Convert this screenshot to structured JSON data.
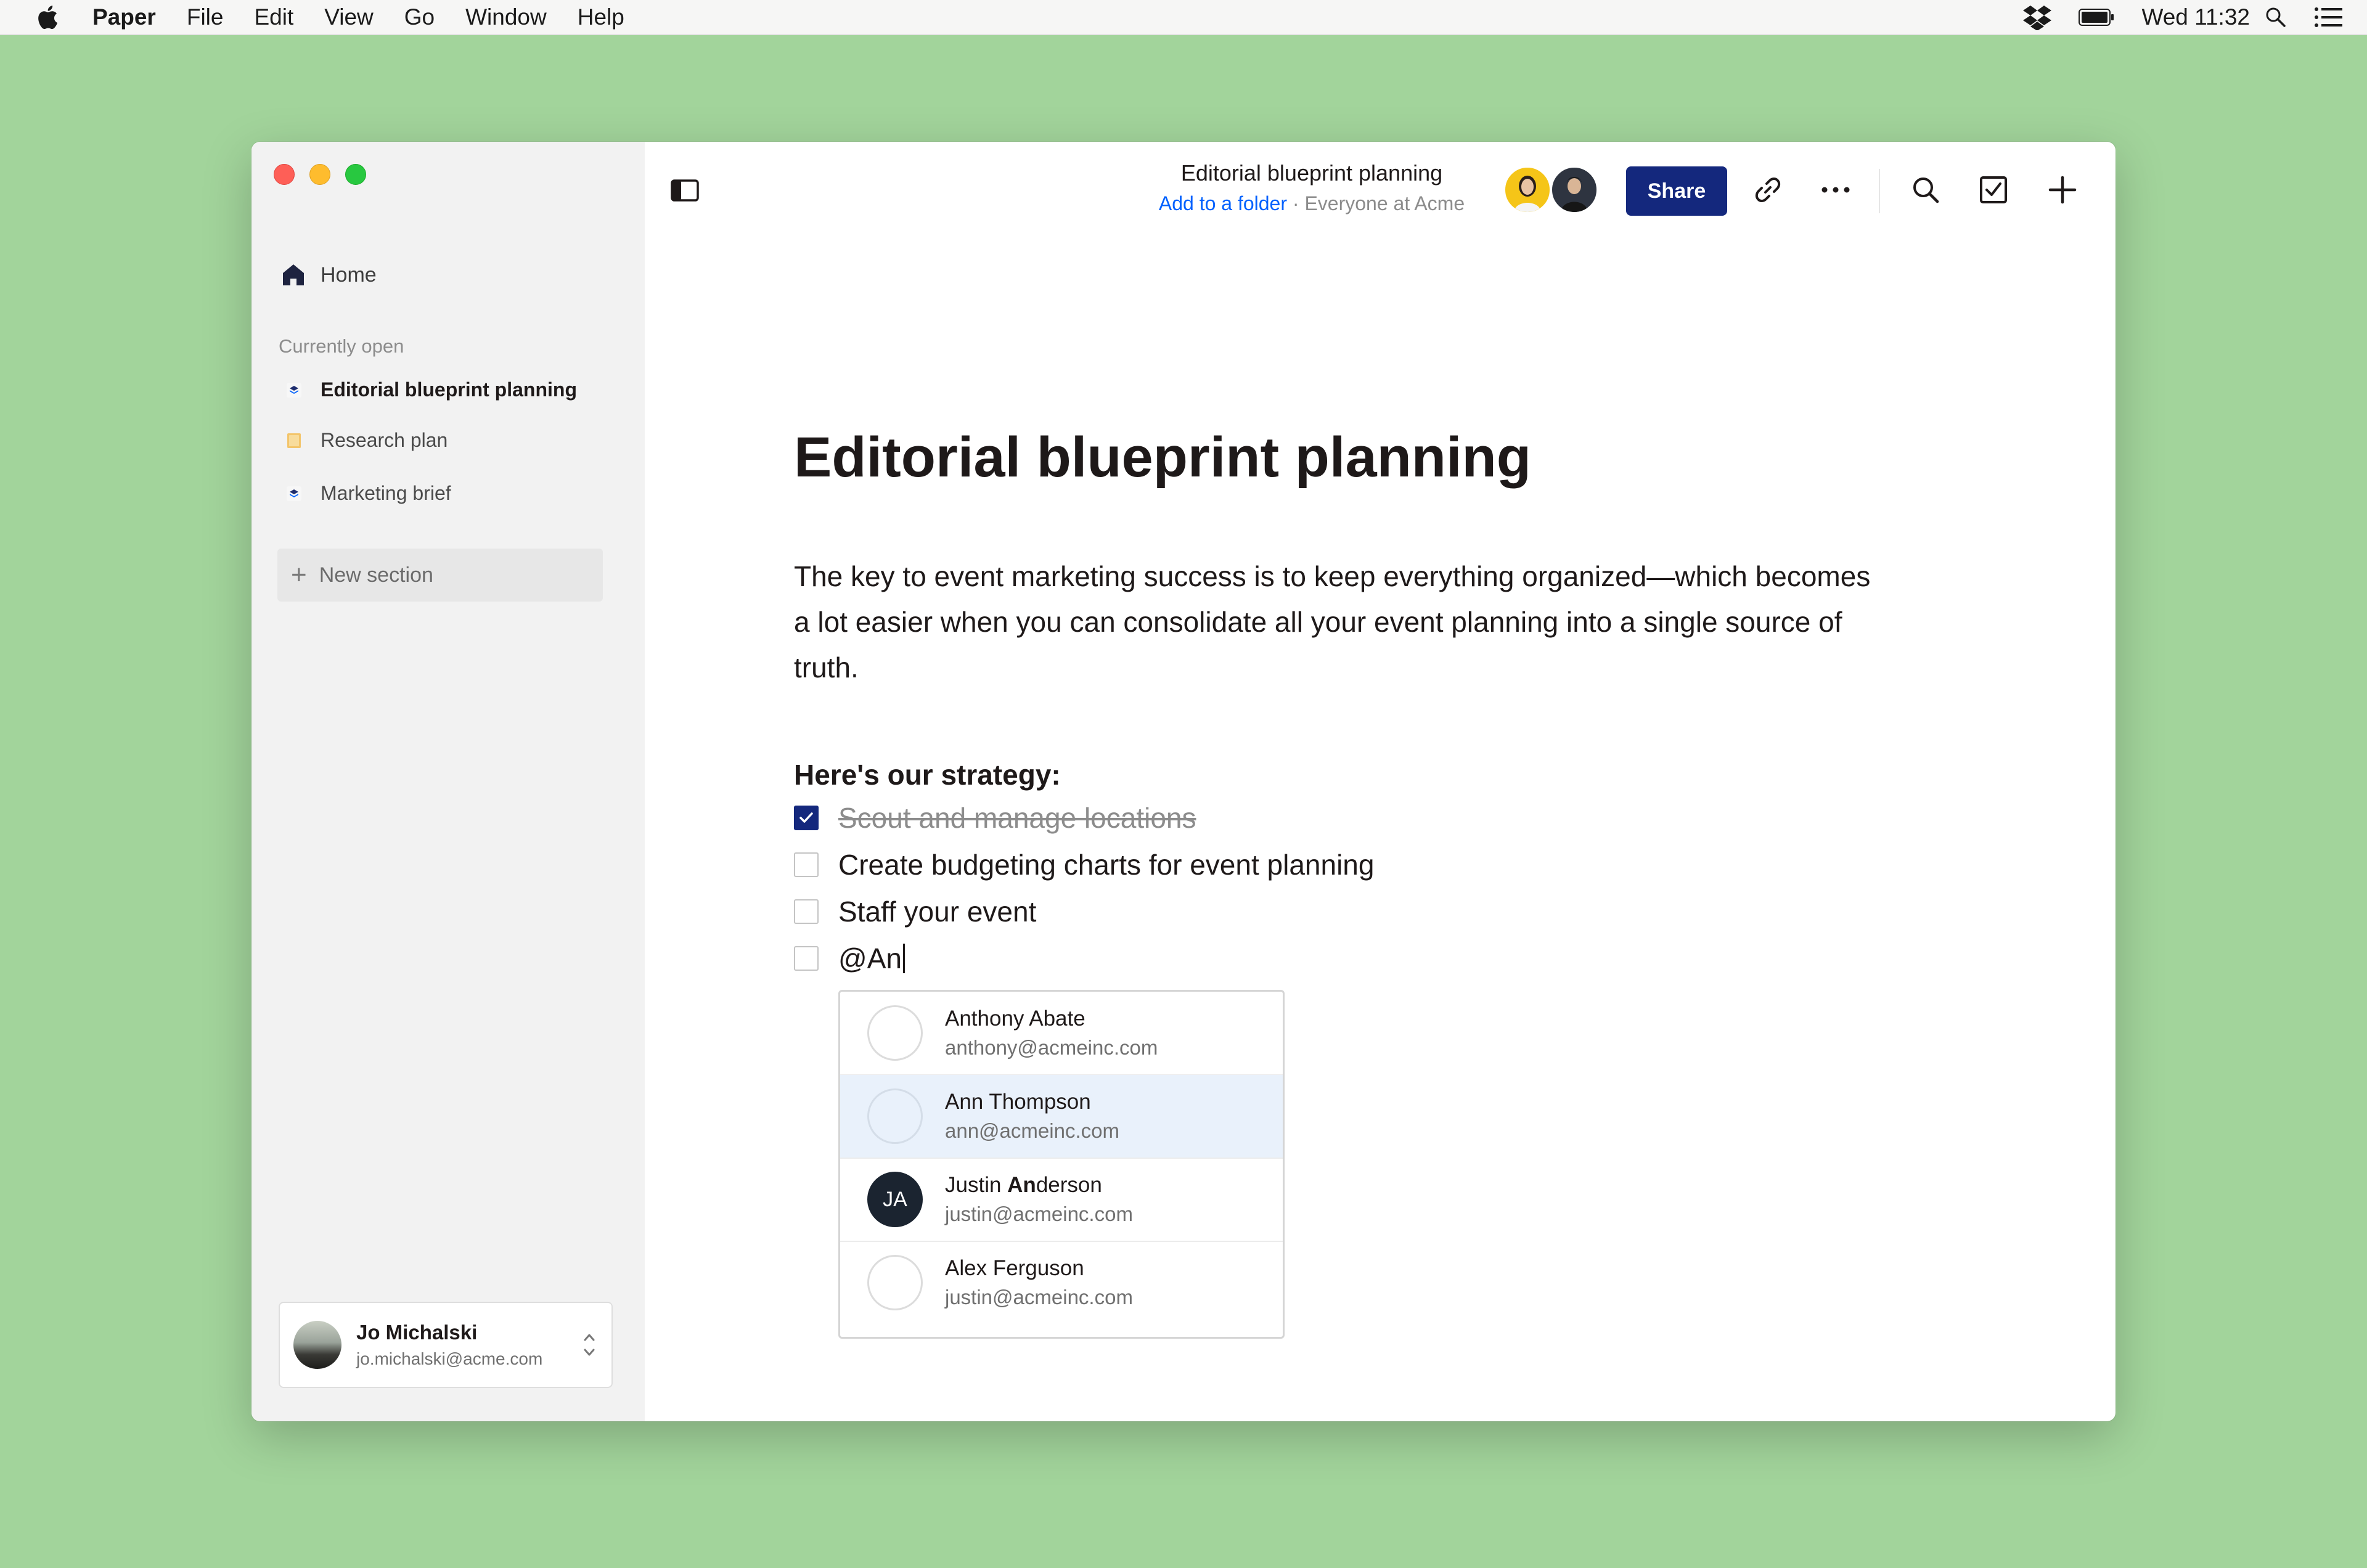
{
  "menubar": {
    "app_name": "Paper",
    "items": [
      "File",
      "Edit",
      "View",
      "Go",
      "Window",
      "Help"
    ],
    "clock": "Wed 11:32",
    "icons": [
      "apple-icon",
      "dropbox-icon",
      "battery-icon",
      "spotlight-icon",
      "notification-center-icon"
    ]
  },
  "sidebar": {
    "home_label": "Home",
    "section_label": "Currently open",
    "docs": [
      {
        "label": "Editorial blueprint planning",
        "icon": "paper-doc-icon",
        "active": true
      },
      {
        "label": "Research plan",
        "icon": "folder-doc-icon",
        "active": false
      },
      {
        "label": "Marketing brief",
        "icon": "paper-doc-icon",
        "active": false
      }
    ],
    "new_section_label": "New section",
    "user": {
      "name": "Jo Michalski",
      "email": "jo.michalski@acme.com"
    }
  },
  "header": {
    "title": "Editorial blueprint planning",
    "add_to_folder": "Add to a folder",
    "separator": " · ",
    "audience": "Everyone at Acme",
    "share_label": "Share",
    "icons": [
      "link-icon",
      "more-icon",
      "search-icon",
      "checklist-icon",
      "add-icon"
    ]
  },
  "doc": {
    "title": "Editorial blueprint planning",
    "paragraph": "The key to event marketing success is to keep everything organized—which becomes a lot easier when you can consolidate all your event planning into a single source of truth.",
    "subhead": "Here's our strategy:",
    "tasks": [
      {
        "text": "Scout and manage locations",
        "checked": true
      },
      {
        "text": "Create budgeting charts for event planning",
        "checked": false
      },
      {
        "text": "Staff your event",
        "checked": false
      },
      {
        "text": "@An",
        "checked": false
      }
    ]
  },
  "mention": {
    "people": [
      {
        "name": "Anthony Abate",
        "email": "anthony@acmeinc.com",
        "initials": ""
      },
      {
        "name": "Ann Thompson",
        "email": "ann@acmeinc.com",
        "initials": ""
      },
      {
        "name_pre": "Justin ",
        "name_match": "An",
        "name_post": "derson",
        "email": "justin@acmeinc.com",
        "initials": "JA"
      },
      {
        "name": "Alex Ferguson",
        "email": "justin@acmeinc.com",
        "initials": ""
      }
    ]
  },
  "colors": {
    "accent": "#14287d",
    "desktop": "#a2d49b",
    "link": "#0061fe"
  }
}
